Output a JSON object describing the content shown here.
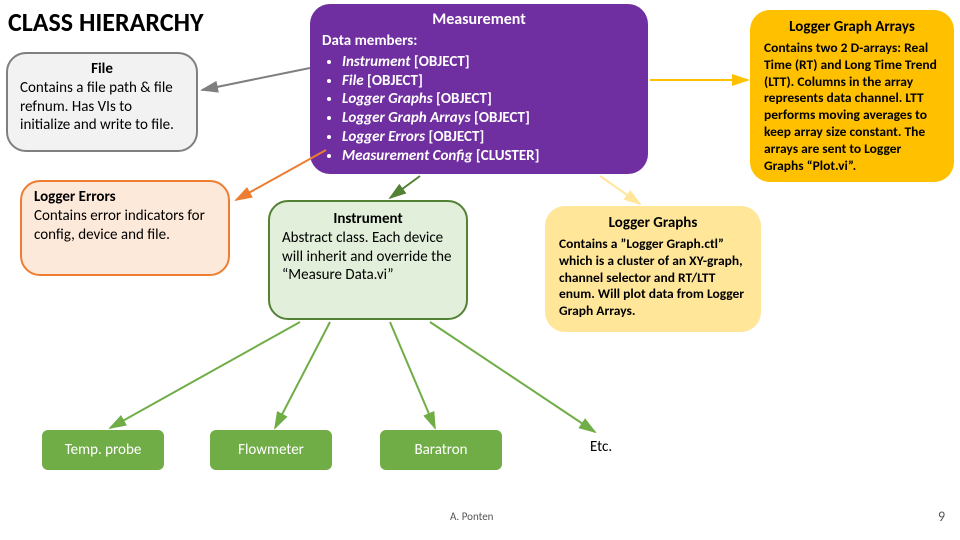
{
  "header": {
    "title": "CLASS HIERARCHY"
  },
  "file": {
    "title": "File",
    "body": "Contains a file path & file refnum. Has VIs to initialize and write to file."
  },
  "errors": {
    "title": "Logger Errors",
    "body": "Contains error indicators for config, device and file."
  },
  "measurement": {
    "title": "Measurement",
    "subhead": "Data members:",
    "items": [
      {
        "name": "Instrument",
        "type": "[OBJECT]"
      },
      {
        "name": "File",
        "type": "[OBJECT]"
      },
      {
        "name": "Logger Graphs",
        "type": "[OBJECT]"
      },
      {
        "name": "Logger Graph Arrays",
        "type": "[OBJECT]"
      },
      {
        "name": "Logger Errors",
        "type": "[OBJECT]"
      },
      {
        "name": "Measurement Config",
        "type": "[CLUSTER]"
      }
    ]
  },
  "arrays": {
    "title": "Logger Graph Arrays",
    "body": "Contains two 2 D-arrays: Real Time (RT) and Long Time Trend (LTT). Columns in the array represents data channel. LTT performs moving averages to keep array size constant. The arrays are sent to Logger Graphs “Plot.vi”."
  },
  "instrument": {
    "title": "Instrument",
    "body": "Abstract class. Each device will inherit and override the “Measure Data.vi”"
  },
  "graphs": {
    "title": "Logger Graphs",
    "body": "Contains a ”Logger Graph.ctl” which is a cluster of an XY-graph, channel selector and RT/LTT enum. Will plot data from Logger Graph Arrays."
  },
  "leaves": {
    "temp": "Temp. probe",
    "flow": "Flowmeter",
    "bara": "Baratron",
    "etc": "Etc."
  },
  "footer": {
    "author": "A. Ponten",
    "page": "9"
  },
  "chart_data": {
    "type": "diagram",
    "title": "CLASS HIERARCHY",
    "root": "Measurement",
    "members": [
      "Instrument [OBJECT]",
      "File [OBJECT]",
      "Logger Graphs [OBJECT]",
      "Logger Graph Arrays [OBJECT]",
      "Logger Errors [OBJECT]",
      "Measurement Config [CLUSTER]"
    ],
    "associated_classes": [
      "File",
      "Logger Errors",
      "Logger Graph Arrays",
      "Logger Graphs",
      "Instrument"
    ],
    "instrument_subclasses": [
      "Temp. probe",
      "Flowmeter",
      "Baratron",
      "Etc."
    ]
  }
}
